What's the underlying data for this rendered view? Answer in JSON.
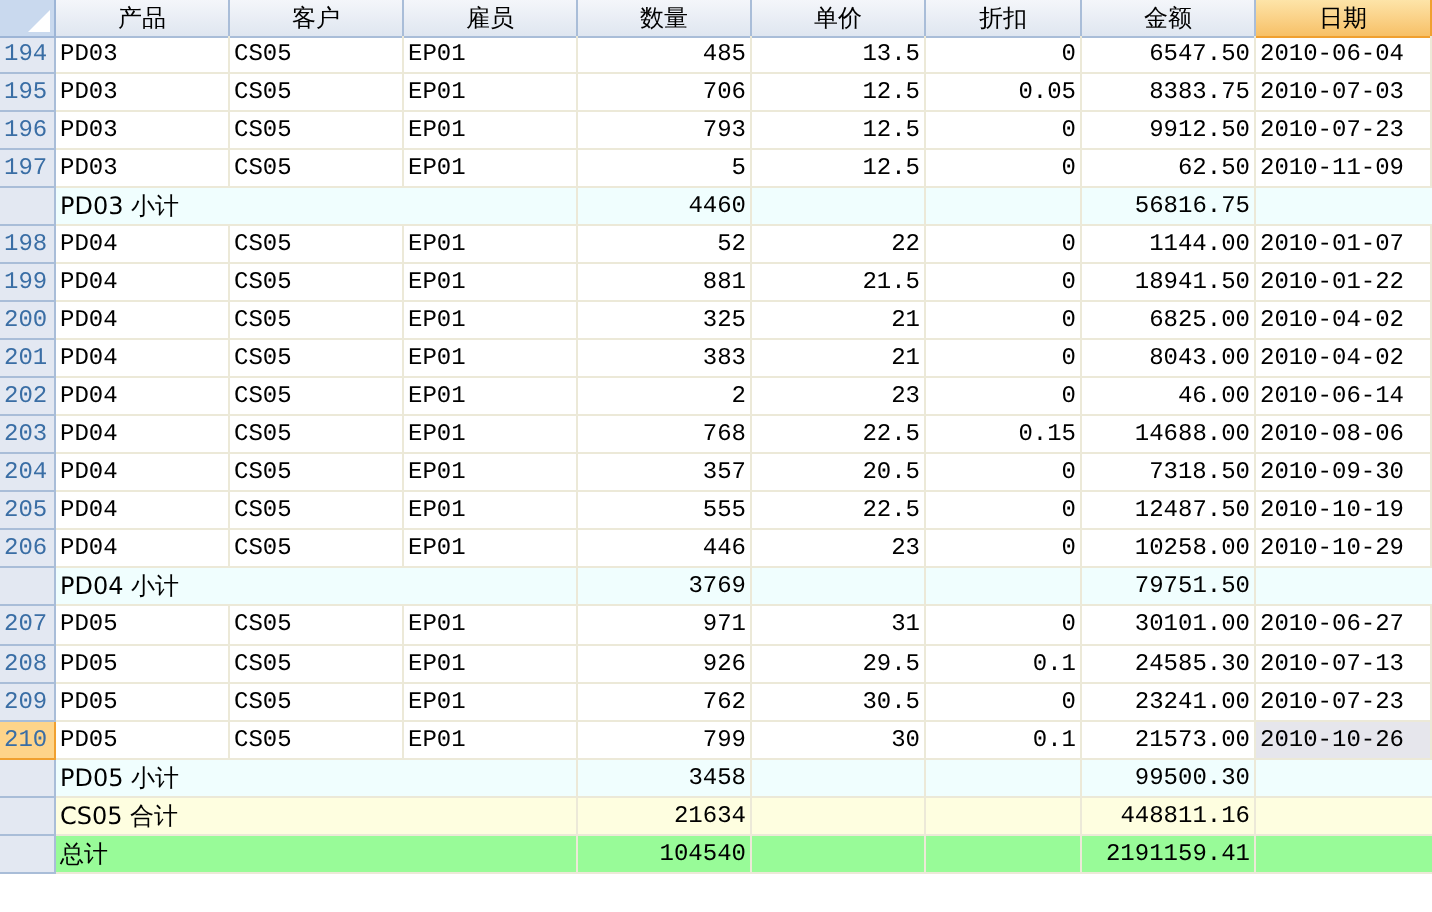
{
  "columns": [
    {
      "label": "产品",
      "selected": false
    },
    {
      "label": "客户",
      "selected": false
    },
    {
      "label": "雇员",
      "selected": false
    },
    {
      "label": "数量",
      "selected": false
    },
    {
      "label": "单价",
      "selected": false
    },
    {
      "label": "折扣",
      "selected": false
    },
    {
      "label": "金额",
      "selected": false
    },
    {
      "label": "日期",
      "selected": true
    }
  ],
  "rows": [
    {
      "kind": "data",
      "number": "194",
      "selected": false,
      "cells": [
        "PD03",
        "CS05",
        "EP01",
        "485",
        "13.5",
        "0",
        "6547.50",
        "2010-06-04"
      ]
    },
    {
      "kind": "data",
      "number": "195",
      "selected": false,
      "cells": [
        "PD03",
        "CS05",
        "EP01",
        "706",
        "12.5",
        "0.05",
        "8383.75",
        "2010-07-03"
      ]
    },
    {
      "kind": "data",
      "number": "196",
      "selected": false,
      "cells": [
        "PD03",
        "CS05",
        "EP01",
        "793",
        "12.5",
        "0",
        "9912.50",
        "2010-07-23"
      ]
    },
    {
      "kind": "data",
      "number": "197",
      "selected": false,
      "cells": [
        "PD03",
        "CS05",
        "EP01",
        "5",
        "12.5",
        "0",
        "62.50",
        "2010-11-09"
      ]
    },
    {
      "kind": "subtotal",
      "label": "PD03 小计",
      "quantity": "4460",
      "amount": "56816.75"
    },
    {
      "kind": "data",
      "number": "198",
      "selected": false,
      "cells": [
        "PD04",
        "CS05",
        "EP01",
        "52",
        "22",
        "0",
        "1144.00",
        "2010-01-07"
      ]
    },
    {
      "kind": "data",
      "number": "199",
      "selected": false,
      "cells": [
        "PD04",
        "CS05",
        "EP01",
        "881",
        "21.5",
        "0",
        "18941.50",
        "2010-01-22"
      ]
    },
    {
      "kind": "data",
      "number": "200",
      "selected": false,
      "cells": [
        "PD04",
        "CS05",
        "EP01",
        "325",
        "21",
        "0",
        "6825.00",
        "2010-04-02"
      ]
    },
    {
      "kind": "data",
      "number": "201",
      "selected": false,
      "cells": [
        "PD04",
        "CS05",
        "EP01",
        "383",
        "21",
        "0",
        "8043.00",
        "2010-04-02"
      ]
    },
    {
      "kind": "data",
      "number": "202",
      "selected": false,
      "cells": [
        "PD04",
        "CS05",
        "EP01",
        "2",
        "23",
        "0",
        "46.00",
        "2010-06-14"
      ]
    },
    {
      "kind": "data",
      "number": "203",
      "selected": false,
      "cells": [
        "PD04",
        "CS05",
        "EP01",
        "768",
        "22.5",
        "0.15",
        "14688.00",
        "2010-08-06"
      ]
    },
    {
      "kind": "data",
      "number": "204",
      "selected": false,
      "cells": [
        "PD04",
        "CS05",
        "EP01",
        "357",
        "20.5",
        "0",
        "7318.50",
        "2010-09-30"
      ]
    },
    {
      "kind": "data",
      "number": "205",
      "selected": false,
      "cells": [
        "PD04",
        "CS05",
        "EP01",
        "555",
        "22.5",
        "0",
        "12487.50",
        "2010-10-19"
      ]
    },
    {
      "kind": "data",
      "number": "206",
      "selected": false,
      "cells": [
        "PD04",
        "CS05",
        "EP01",
        "446",
        "23",
        "0",
        "10258.00",
        "2010-10-29"
      ]
    },
    {
      "kind": "subtotal",
      "label": "PD04 小计",
      "quantity": "3769",
      "amount": "79751.50"
    },
    {
      "kind": "data",
      "number": "207",
      "selected": false,
      "cells": [
        "PD05",
        "CS05",
        "EP01",
        "971",
        "31",
        "0",
        "30101.00",
        "2010-06-27"
      ]
    },
    {
      "kind": "data",
      "number": "208",
      "selected": false,
      "cells": [
        "PD05",
        "CS05",
        "EP01",
        "926",
        "29.5",
        "0.1",
        "24585.30",
        "2010-07-13"
      ]
    },
    {
      "kind": "data",
      "number": "209",
      "selected": false,
      "cells": [
        "PD05",
        "CS05",
        "EP01",
        "762",
        "30.5",
        "0",
        "23241.00",
        "2010-07-23"
      ]
    },
    {
      "kind": "data",
      "number": "210",
      "selected": true,
      "cells": [
        "PD05",
        "CS05",
        "EP01",
        "799",
        "30",
        "0.1",
        "21573.00",
        "2010-10-26"
      ]
    },
    {
      "kind": "subtotal",
      "label": "PD05 小计",
      "quantity": "3458",
      "amount": "99500.30"
    },
    {
      "kind": "group_total",
      "label": "CS05 合计",
      "quantity": "21634",
      "amount": "448811.16"
    },
    {
      "kind": "grand_total",
      "label": "总计",
      "quantity": "104540",
      "amount": "2191159.41"
    }
  ]
}
